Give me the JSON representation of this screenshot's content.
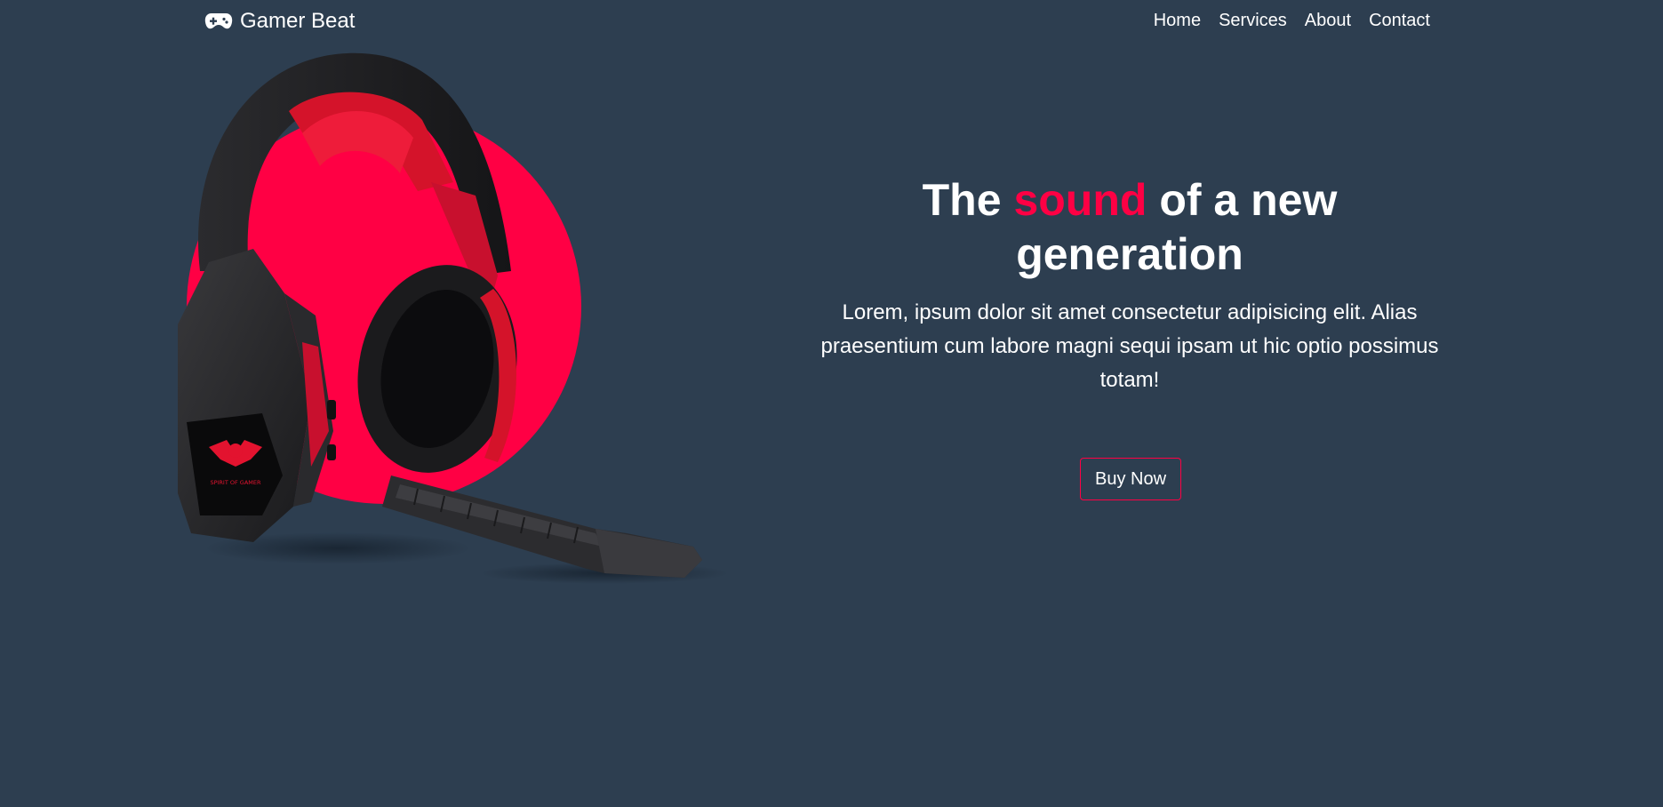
{
  "brand": {
    "icon": "gamepad-icon",
    "name": "Gamer Beat"
  },
  "nav": {
    "items": [
      {
        "label": "Home"
      },
      {
        "label": "Services"
      },
      {
        "label": "About"
      },
      {
        "label": "Contact"
      }
    ]
  },
  "hero": {
    "title_before": "The ",
    "title_accent": "sound",
    "title_after": " of a new generation",
    "description": "Lorem, ipsum dolor sit amet consectetur adipisicing elit. Alias praesentium cum labore magni sequi ipsam ut hic optio possimus totam!",
    "button_label": "Buy Now",
    "image_icon": "gaming-headset-image",
    "image_logo_text": "SPIRIT OF GAMER"
  },
  "colors": {
    "background": "#2d3e50",
    "accent": "#ff0044",
    "text": "#ffffff"
  }
}
